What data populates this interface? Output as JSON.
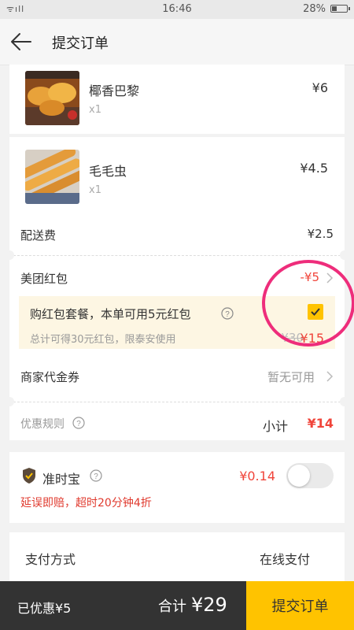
{
  "status_bar": {
    "signal": "ᯤıll",
    "time": "16:46",
    "battery": "28%"
  },
  "nav": {
    "title": "提交订单"
  },
  "items": [
    {
      "name": "椰香巴黎",
      "qty": "x1",
      "price": "¥6"
    },
    {
      "name": "毛毛虫",
      "qty": "x1",
      "price": "¥4.5"
    }
  ],
  "delivery": {
    "label": "配送费",
    "value": "¥2.5"
  },
  "red_packet": {
    "label": "美团红包",
    "value": "-¥5"
  },
  "promo": {
    "title": "购红包套餐，本单可用5元红包",
    "desc": "总计可得30元红包，限泰安使用",
    "old_price": "¥30",
    "new_price": "¥15",
    "checked": true
  },
  "voucher": {
    "label": "商家代金券",
    "value": "暂无可用"
  },
  "rules": {
    "label": "优惠规则",
    "subtotal_label": "小计",
    "subtotal": "¥14"
  },
  "ontime": {
    "title": "准时宝",
    "price": "¥0.14",
    "desc": "延误即赔，超时20分钟4折"
  },
  "payment": {
    "label": "支付方式",
    "value": "在线支付"
  },
  "bottom": {
    "saved": "已优惠¥5",
    "total_label": "合计",
    "total": "¥29",
    "submit": "提交订单"
  },
  "colors": {
    "accent": "#ffc300",
    "red": "#f0443a",
    "dark": "#333333",
    "highlight": "#ee2d7b"
  }
}
